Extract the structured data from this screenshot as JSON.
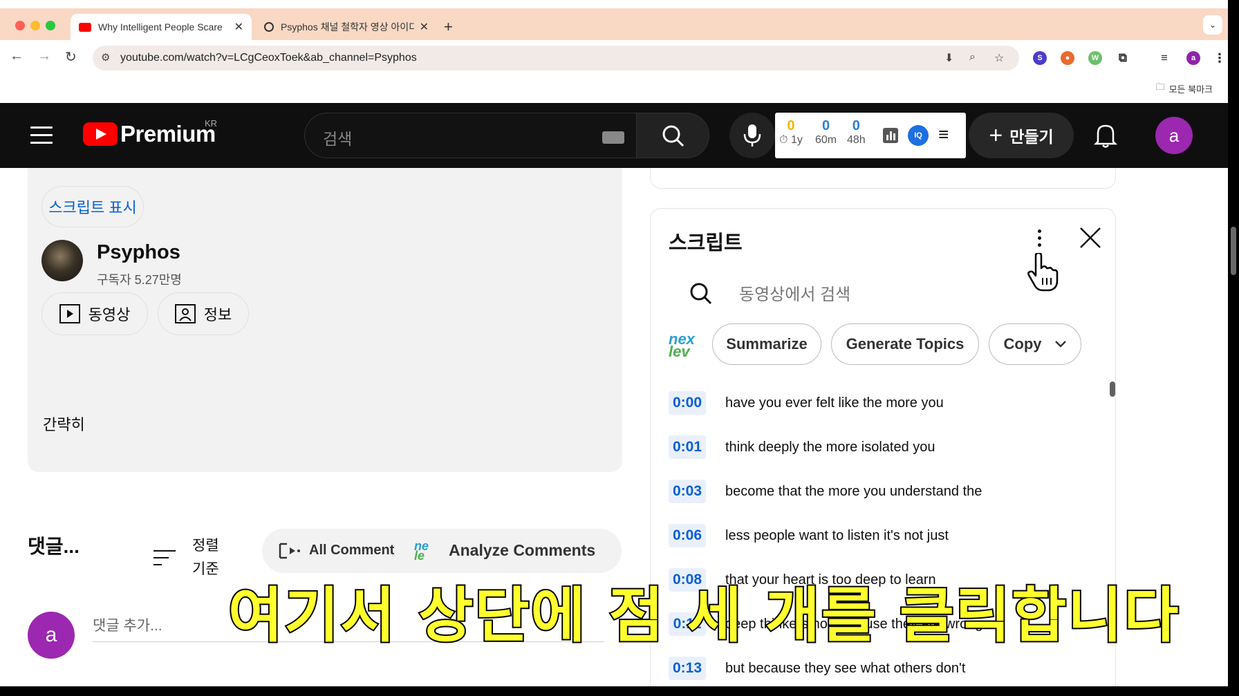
{
  "browser": {
    "tabs": [
      {
        "title": "Why Intelligent People Scare",
        "active": true
      },
      {
        "title": "Psyphos 채널 철학자 영상 아이디",
        "active": false
      }
    ],
    "new_tab": "+",
    "address": "youtube.com/watch?v=LCgCeoxToek&ab_channel=Psyphos",
    "bookmarks_all": "모든 북마크",
    "profile_initial": "a"
  },
  "youtube": {
    "logo_text": "Premium",
    "country": "KR",
    "search_placeholder": "검색",
    "create_label": "만들기",
    "avatar_initial": "a",
    "stats": [
      {
        "value": "0",
        "label": "1y",
        "color": "#f5b400"
      },
      {
        "value": "0",
        "label": "60m",
        "color": "#2a7fd4"
      },
      {
        "value": "0",
        "label": "48h",
        "color": "#2a7fd4"
      }
    ]
  },
  "description": {
    "show_transcript": "스크립트 표시",
    "channel_name": "Psyphos",
    "subscribers": "구독자 5.27만명",
    "videos_button": "동영상",
    "about_button": "정보",
    "collapse": "간략히"
  },
  "comments": {
    "title": "댓글...",
    "sort_label": "정렬 기준",
    "all_comments": "All Comments",
    "analyze_comments": "Analyze Comments",
    "avatar_initial": "a",
    "add_placeholder": "댓글 추가..."
  },
  "transcript": {
    "title": "스크립트",
    "search_placeholder": "동영상에서 검색",
    "brand_top": "nex",
    "brand_bottom": "lev",
    "buttons": {
      "summarize": "Summarize",
      "topics": "Generate Topics",
      "copy": "Copy"
    },
    "segments": [
      {
        "time": "0:00",
        "text": "have you ever felt like the more you"
      },
      {
        "time": "0:01",
        "text": "think deeply the more isolated you"
      },
      {
        "time": "0:03",
        "text": "become that the more you understand the"
      },
      {
        "time": "0:06",
        "text": "less people want to listen it's not just"
      },
      {
        "time": "0:08",
        "text": "that your heart is too deep to learn"
      },
      {
        "time": "0:11",
        "text": "deep thinkers not because they are wrong"
      },
      {
        "time": "0:13",
        "text": "but because they see what others don't"
      }
    ]
  },
  "overlay_caption": "여기서 상단에 점 세 개를 클릭합니다"
}
